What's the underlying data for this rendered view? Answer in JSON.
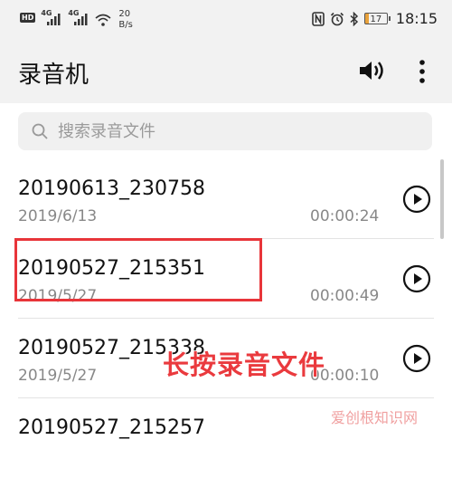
{
  "status_bar": {
    "hd": "HD",
    "net1": "4G",
    "net2": "4G",
    "speed_value": "20",
    "speed_unit": "B/s",
    "battery": "17",
    "time": "18:15"
  },
  "app_bar": {
    "title": "录音机",
    "speaker_icon": "speaker-icon",
    "more_icon": "more-vertical-icon"
  },
  "search": {
    "placeholder": "搜索录音文件"
  },
  "recordings": [
    {
      "name": "20190613_230758",
      "date": "2019/6/13",
      "duration": "00:00:24"
    },
    {
      "name": "20190527_215351",
      "date": "2019/5/27",
      "duration": "00:00:49"
    },
    {
      "name": "20190527_215338",
      "date": "2019/5/27",
      "duration": "00:00:10"
    },
    {
      "name": "20190527_215257",
      "date": "",
      "duration": ""
    }
  ],
  "annotation": {
    "text": "长按录音文件",
    "color": "#ea3a3e"
  },
  "watermark": {
    "text": "爱创根知识网"
  },
  "colors": {
    "bar_bg": "#f2f2f2",
    "highlight": "#e8353a",
    "battery_fill": "#e9a23b"
  }
}
